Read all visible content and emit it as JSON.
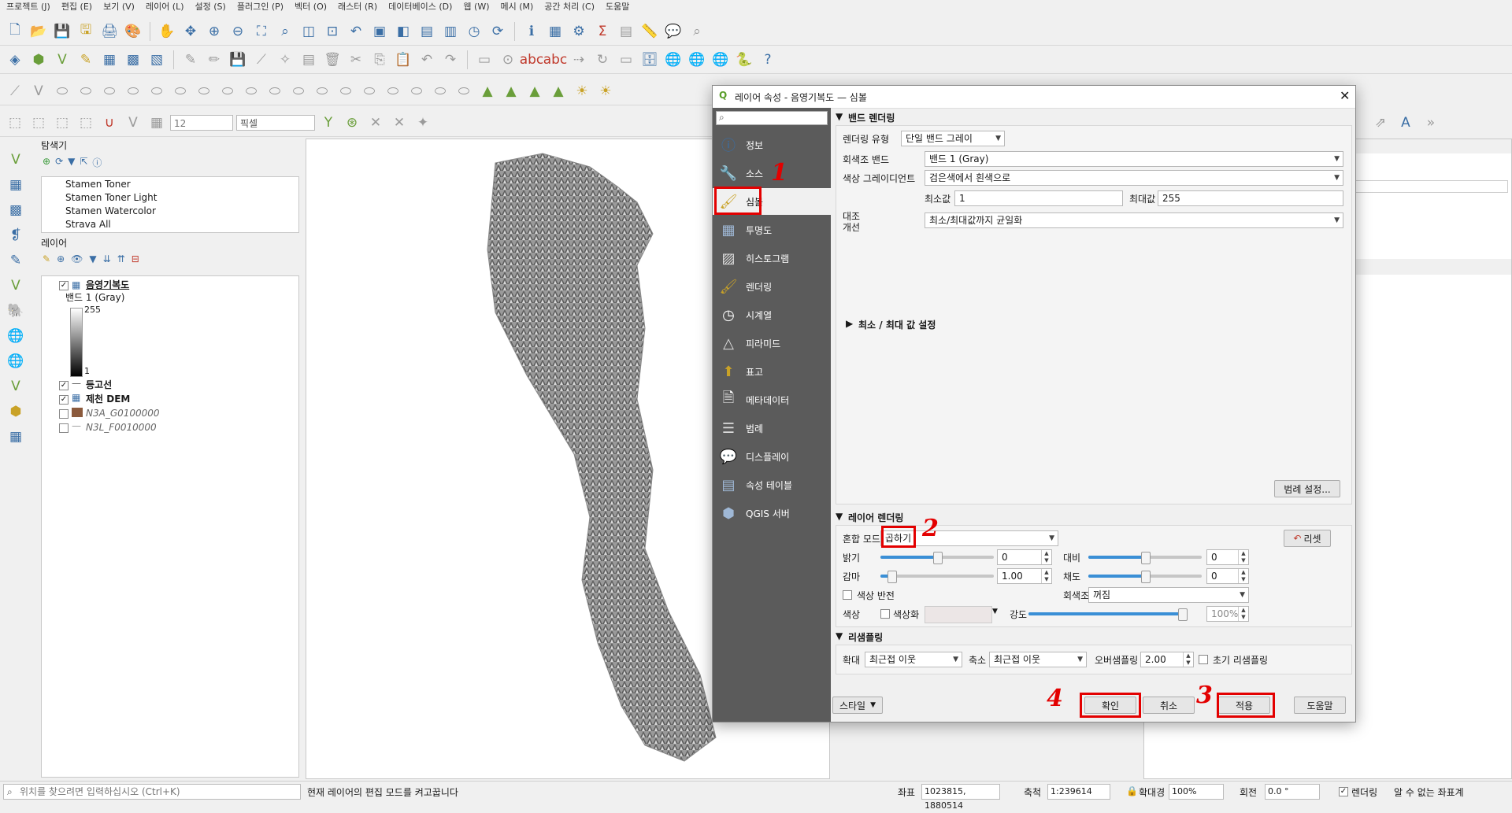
{
  "menubar": [
    "프로젝트 (J)",
    "편집 (E)",
    "보기 (V)",
    "레이어 (L)",
    "설정 (S)",
    "플러그인 (P)",
    "벡터 (O)",
    "래스터 (R)",
    "데이터베이스 (D)",
    "웹 (W)",
    "메시 (M)",
    "공간 처리 (C)",
    "도움말"
  ],
  "toolbar": {
    "font_size": "12",
    "unit": "픽셀"
  },
  "browser": {
    "title": "탐색기",
    "items": [
      "Stamen Toner",
      "Stamen Toner Light",
      "Stamen Watercolor",
      "Strava All"
    ]
  },
  "layers": {
    "title": "레이어",
    "items": [
      {
        "name": "음영기복도",
        "checked": true,
        "legend_label": "밴드 1 (Gray)",
        "max": "255",
        "min": "1"
      },
      {
        "name": "등고선",
        "checked": true
      },
      {
        "name": "제천 DEM",
        "checked": true
      },
      {
        "name": "N3A_G0100000",
        "checked": false
      },
      {
        "name": "N3L_F0010000",
        "checked": false
      }
    ]
  },
  "dialog": {
    "title": "레이어 속성 - 음영기복도 — 심볼",
    "search_placeholder": "",
    "sidebar": [
      "정보",
      "소스",
      "심볼",
      "투명도",
      "히스토그램",
      "렌더링",
      "시계열",
      "피라미드",
      "표고",
      "메타데이터",
      "범례",
      "디스플레이",
      "속성 테이블",
      "QGIS 서버"
    ],
    "selected_sidebar": "심볼",
    "band_rendering": {
      "header": "밴드 렌더링",
      "render_type_label": "렌더링 유형",
      "render_type_value": "단일 밴드 그레이",
      "gray_band_label": "회색조 밴드",
      "gray_band_value": "밴드 1 (Gray)",
      "gradient_label": "색상 그레이디언트",
      "gradient_value": "검은색에서 흰색으로",
      "min_label": "최소값",
      "min_value": "1",
      "max_label": "최대값",
      "max_value": "255",
      "contrast_label_1": "대조",
      "contrast_label_2": "개선",
      "contrast_value": "최소/최대값까지 균일화",
      "minmax_section": "최소 / 최대 값 설정",
      "legend_button": "범례 설정..."
    },
    "layer_rendering": {
      "header": "레이어 렌더링",
      "blend_label": "혼합 모드",
      "blend_value": "곱하기",
      "reset_button": "리셋",
      "brightness_label": "밝기",
      "brightness_value": "0",
      "brightness_level": 0.5,
      "contrast_label": "대비",
      "contrast_value": "0",
      "contrast_level": 0.5,
      "gamma_label": "감마",
      "gamma_value": "1.00",
      "gamma_level": 0.1,
      "saturation_label": "채도",
      "saturation_value": "0",
      "saturation_level": 0.5,
      "invert_label": "색상 반전",
      "grayscale_label": "회색조",
      "grayscale_value": "꺼짐",
      "hue_label": "색상",
      "colorize_label": "색상화",
      "strength_label": "강도",
      "strength_value": "100%",
      "strength_level": 1.0
    },
    "resampling": {
      "header": "리샘플링",
      "zoom_in_label": "확대",
      "zoom_in_value": "최근접 이웃",
      "zoom_out_label": "축소",
      "zoom_out_value": "최근접 이웃",
      "oversampling_label": "오버샘플링",
      "oversampling_value": "2.00",
      "early_resample_label": "초기 리샘플링"
    },
    "buttons": {
      "style": "스타일",
      "ok": "확인",
      "cancel": "취소",
      "apply": "적용",
      "help": "도움말"
    },
    "annotations": [
      "1",
      "2",
      "3",
      "4"
    ]
  },
  "statusbar": {
    "locate_placeholder": "위치를 찾으려면 입력하십시오 (Ctrl+K)",
    "message": "현재 레이어의 편집 모드를 켜고꿉니다",
    "coord_label": "좌표",
    "coord_value": "1023815, 1880514",
    "scale_label": "축척",
    "scale_value": "1:239614",
    "magnifier_label": "확대경",
    "magnifier_value": "100%",
    "rotation_label": "회전",
    "rotation_value": "0.0 °",
    "render_label": "렌더링",
    "crs_label": "알 수 없는 좌표계"
  },
  "colors": {
    "sidebar_bg": "#5b5b5b",
    "annotation_red": "#e30000",
    "slider_fill": "#3a8fd6"
  }
}
